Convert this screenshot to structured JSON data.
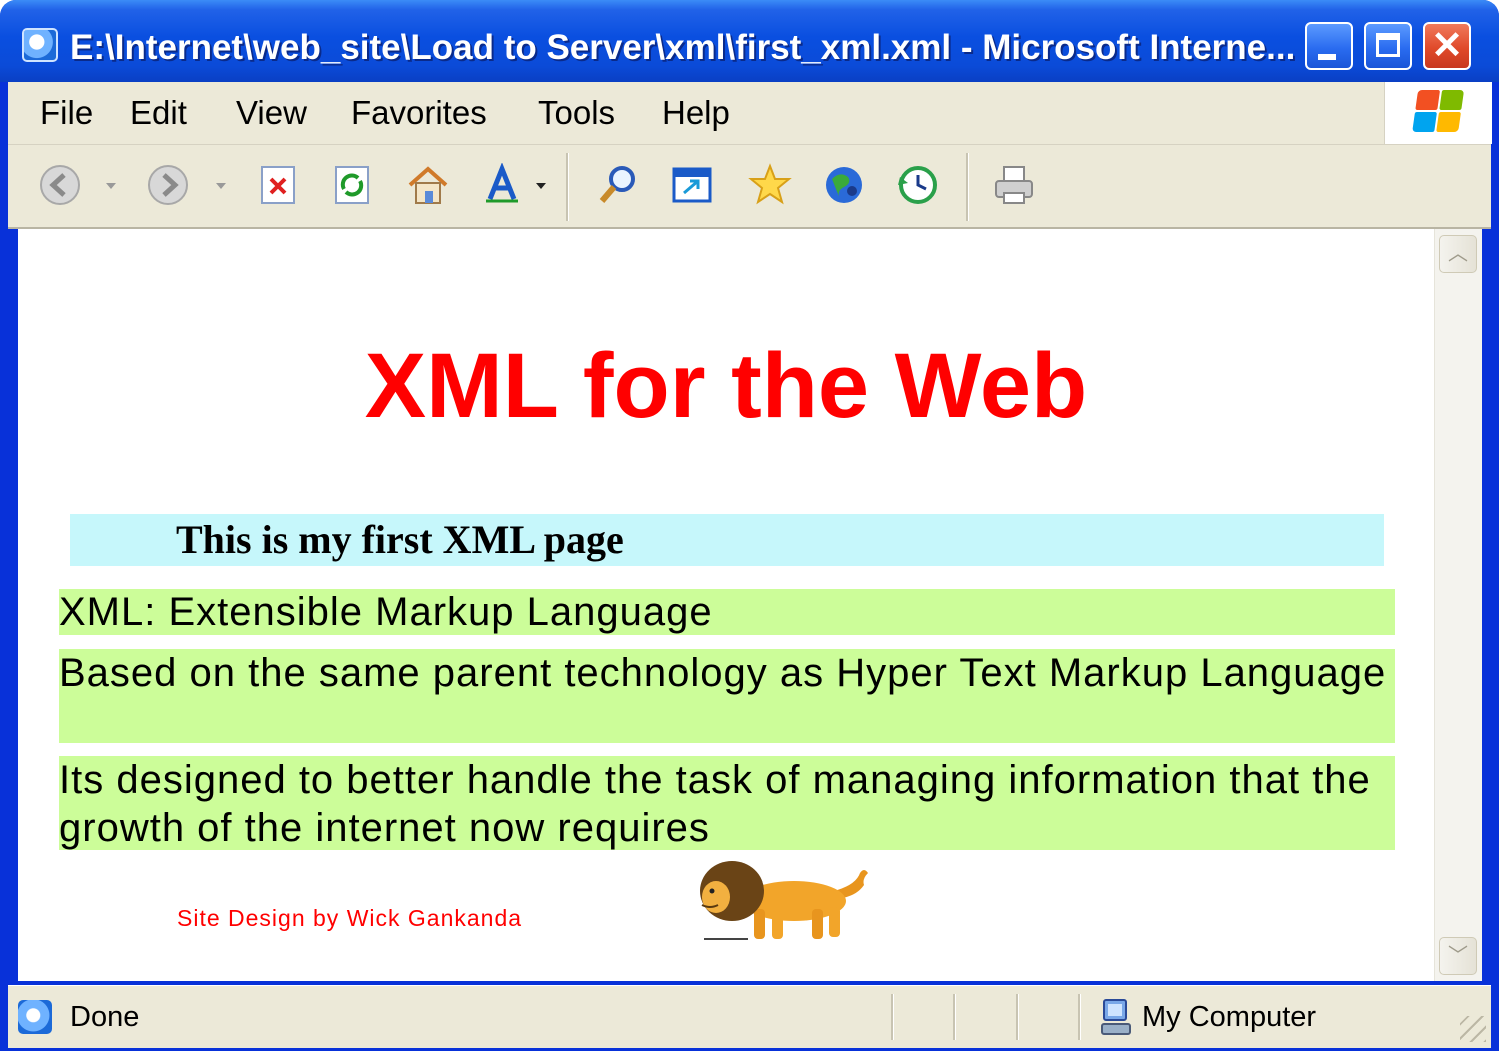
{
  "window": {
    "title": "E:\\Internet\\web_site\\Load to Server\\xml\\first_xml.xml - Microsoft Interne...",
    "close_glyph": "✕"
  },
  "menu": {
    "items": [
      "File",
      "Edit",
      "View",
      "Favorites",
      "Tools",
      "Help"
    ]
  },
  "toolbar": {
    "icons": [
      "back-icon",
      "forward-icon",
      "stop-icon",
      "refresh-icon",
      "home-icon",
      "font-size-icon",
      "search-icon",
      "popup-icon",
      "favorites-icon",
      "media-icon",
      "history-icon",
      "print-icon"
    ]
  },
  "page": {
    "heading": "XML for the Web",
    "subtitle": "This is my first XML page",
    "paragraphs": [
      "XML: Extensible Markup Language",
      "Based on the same parent technology as Hyper Text Markup Language",
      "Its designed to better handle the task of managing information that the growth of the internet now requires"
    ],
    "credit": "Site Design by Wick Gankanda"
  },
  "status": {
    "text": "Done",
    "zone": "My Computer"
  },
  "colors": {
    "heading": "#ff0000",
    "subtitle_bg": "#c6f7fb",
    "paragraph_bg": "#ccfd99",
    "credit": "#ff0000",
    "titlebar": "#0a4fe0"
  }
}
